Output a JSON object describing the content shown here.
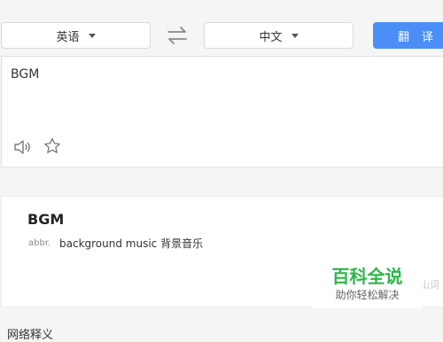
{
  "source_lang": {
    "label": "英语"
  },
  "target_lang": {
    "label": "中文"
  },
  "icons": {
    "swap": "swap-arrows-icon",
    "speaker": "speaker-icon",
    "star": "star-icon",
    "caret": "caret-down-icon"
  },
  "translate_button": {
    "label": "翻译"
  },
  "input": {
    "text": "BGM"
  },
  "result": {
    "word": "BGM",
    "pos": "abbr.",
    "definition": "background music 背景音乐"
  },
  "watermark": {
    "title": "百科全说",
    "subtitle": "助你轻松解决",
    "edge_text": "山词"
  },
  "bottom_partial_text": "网络释义",
  "colors": {
    "accent": "#4b8ef7",
    "watermark_green": "#2fb64a"
  }
}
